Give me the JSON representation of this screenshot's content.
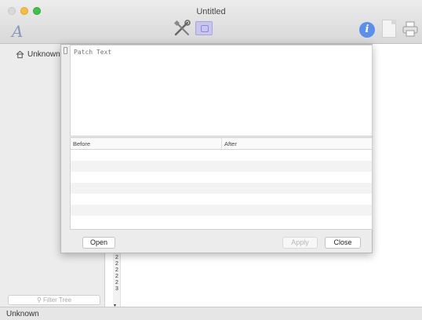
{
  "window": {
    "title": "Untitled"
  },
  "toolbar": {
    "font_icon": "font-icon",
    "tools_icon": "tools-icon",
    "patch_icon": "patch-icon",
    "info_icon": "info-icon",
    "document_icon": "document-icon",
    "print_icon": "print-icon"
  },
  "sidebar": {
    "items": [
      {
        "label": "Unknown",
        "icon": "house-icon"
      }
    ],
    "filter_placeholder": "Filter Tree"
  },
  "editor": {
    "gutter_numbers": [
      "2",
      "2",
      "2",
      "2",
      "2",
      "3"
    ]
  },
  "dialog": {
    "patch_placeholder": "Patch Text",
    "columns": [
      "Before",
      "After"
    ],
    "buttons": {
      "open": "Open",
      "apply": "Apply",
      "close": "Close"
    }
  },
  "status": {
    "text": "Unknown"
  },
  "colors": {
    "accent_blue": "#5a8ff0",
    "patch_purple": "#c9c6ee"
  }
}
